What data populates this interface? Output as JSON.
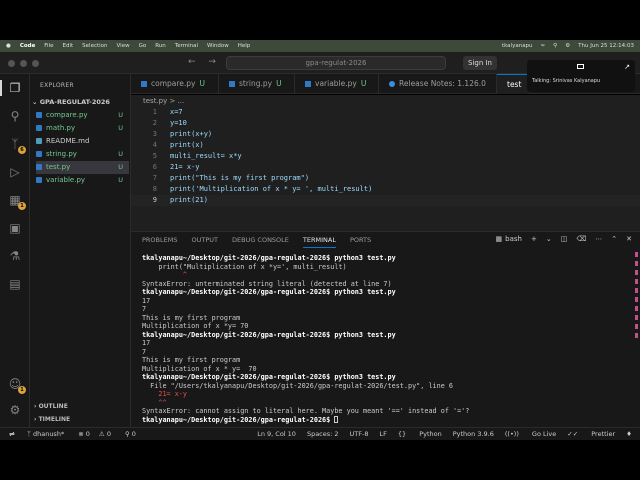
{
  "mac_menu": {
    "app": "Code",
    "items": [
      "File",
      "Edit",
      "Selection",
      "View",
      "Go",
      "Run",
      "Terminal",
      "Window",
      "Help"
    ],
    "user": "tkalyanapu",
    "datetime": "Thu Jun 25  12:14:03"
  },
  "titlebar": {
    "search": "gpa-regulat-2026",
    "signin": "Sign In",
    "back": "←",
    "forward": "→"
  },
  "overlay": {
    "talking": "Talking: Srinivas Kalyanapu"
  },
  "activity_badges": {
    "scm": "6",
    "extensions": "1",
    "accounts": "1"
  },
  "sidebar": {
    "title": "EXPLORER",
    "folder": "GPA-REGULAT-2026",
    "files": [
      {
        "name": "compare.py",
        "status": "U"
      },
      {
        "name": "math.py",
        "status": "U"
      },
      {
        "name": "README.md",
        "status": ""
      },
      {
        "name": "string.py",
        "status": "U"
      },
      {
        "name": "test.py",
        "status": "U"
      },
      {
        "name": "variable.py",
        "status": "U"
      }
    ],
    "outline": "OUTLINE",
    "timeline": "TIMELINE"
  },
  "tabs": [
    {
      "label": "compare.py",
      "status": "U"
    },
    {
      "label": "string.py",
      "status": "U"
    },
    {
      "label": "variable.py",
      "status": "U"
    },
    {
      "label": "Release Notes: 1.126.0",
      "status": ""
    },
    {
      "label": "test",
      "status": ""
    }
  ],
  "breadcrumb": "test.py  >  ...",
  "editor_lines": [
    {
      "n": "1",
      "text": "x=7"
    },
    {
      "n": "2",
      "text": "y=10"
    },
    {
      "n": "3",
      "text": "print(x+y)"
    },
    {
      "n": "4",
      "text": "print(x)"
    },
    {
      "n": "5",
      "text": "multi_result= x*y"
    },
    {
      "n": "6",
      "text": "21= x-y"
    },
    {
      "n": "7",
      "text": "print(\"This is my first program\")"
    },
    {
      "n": "8",
      "text": "print('Multiplication of x * y= ', multi_result)"
    },
    {
      "n": "9",
      "text": "print(21)"
    }
  ],
  "panel": {
    "tabs": [
      "PROBLEMS",
      "OUTPUT",
      "DEBUG CONSOLE",
      "TERMINAL",
      "PORTS"
    ],
    "shell": "bash"
  },
  "terminal_lines": [
    "tkalyanapu~/Desktop/git-2026/gpa-regulat-2026$ python3 test.py",
    "    print(\"Multiplication of x *y=', multi_result)",
    "          ^",
    "SyntaxError: unterminated string literal (detected at line 7)",
    "tkalyanapu~/Desktop/git-2026/gpa-regulat-2026$ python3 test.py",
    "17",
    "7",
    "This is my first program",
    "Multiplication of x *y= 70",
    "tkalyanapu~/Desktop/git-2026/gpa-regulat-2026$ python3 test.py",
    "17",
    "7",
    "This is my first program",
    "Multiplication of x * y=  70",
    "tkalyanapu~/Desktop/git-2026/gpa-regulat-2026$ python3 test.py",
    "  File \"/Users/tkalyanapu/Desktop/git-2026/gpa-regulat-2026/test.py\", line 6",
    "    21= x-y",
    "    ^^",
    "SyntaxError: cannot assign to literal here. Maybe you meant '==' instead of '='?",
    "tkalyanapu~/Desktop/git-2026/gpa-regulat-2026$ "
  ],
  "status": {
    "branch": "dhanush*",
    "errors": "0",
    "warnings": "0",
    "ports": "0",
    "position": "Ln 9, Col 10",
    "spaces": "Spaces: 2",
    "encoding": "UTF-8",
    "eol": "LF",
    "language": "Python",
    "interpreter": "Python 3.9.6",
    "golive": "Go Live",
    "prettier": "Prettier"
  }
}
